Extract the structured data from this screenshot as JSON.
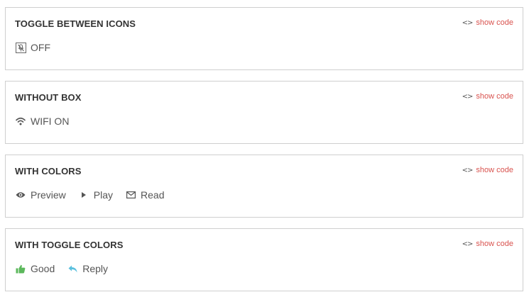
{
  "show_code_label": "show code",
  "code_glyph": "<>",
  "panels": [
    {
      "title": "TOGGLE BETWEEN ICONS",
      "items": [
        {
          "icon": "mic-off-boxed-icon",
          "label": "OFF"
        }
      ]
    },
    {
      "title": "WITHOUT BOX",
      "items": [
        {
          "icon": "wifi-icon",
          "label": "WIFI ON"
        }
      ]
    },
    {
      "title": "WITH COLORS",
      "items": [
        {
          "icon": "eye-icon",
          "label": "Preview"
        },
        {
          "icon": "play-icon",
          "label": "Play"
        },
        {
          "icon": "mail-icon",
          "label": "Read"
        }
      ]
    },
    {
      "title": "WITH TOGGLE COLORS",
      "items": [
        {
          "icon": "thumbs-up-icon",
          "label": "Good",
          "color": "#5cb85c"
        },
        {
          "icon": "reply-icon",
          "label": "Reply",
          "color": "#5bc0de"
        }
      ]
    }
  ],
  "colors": {
    "link": "#d9534f",
    "text": "#555555",
    "heading": "#333333",
    "border": "#cfcfcf"
  }
}
